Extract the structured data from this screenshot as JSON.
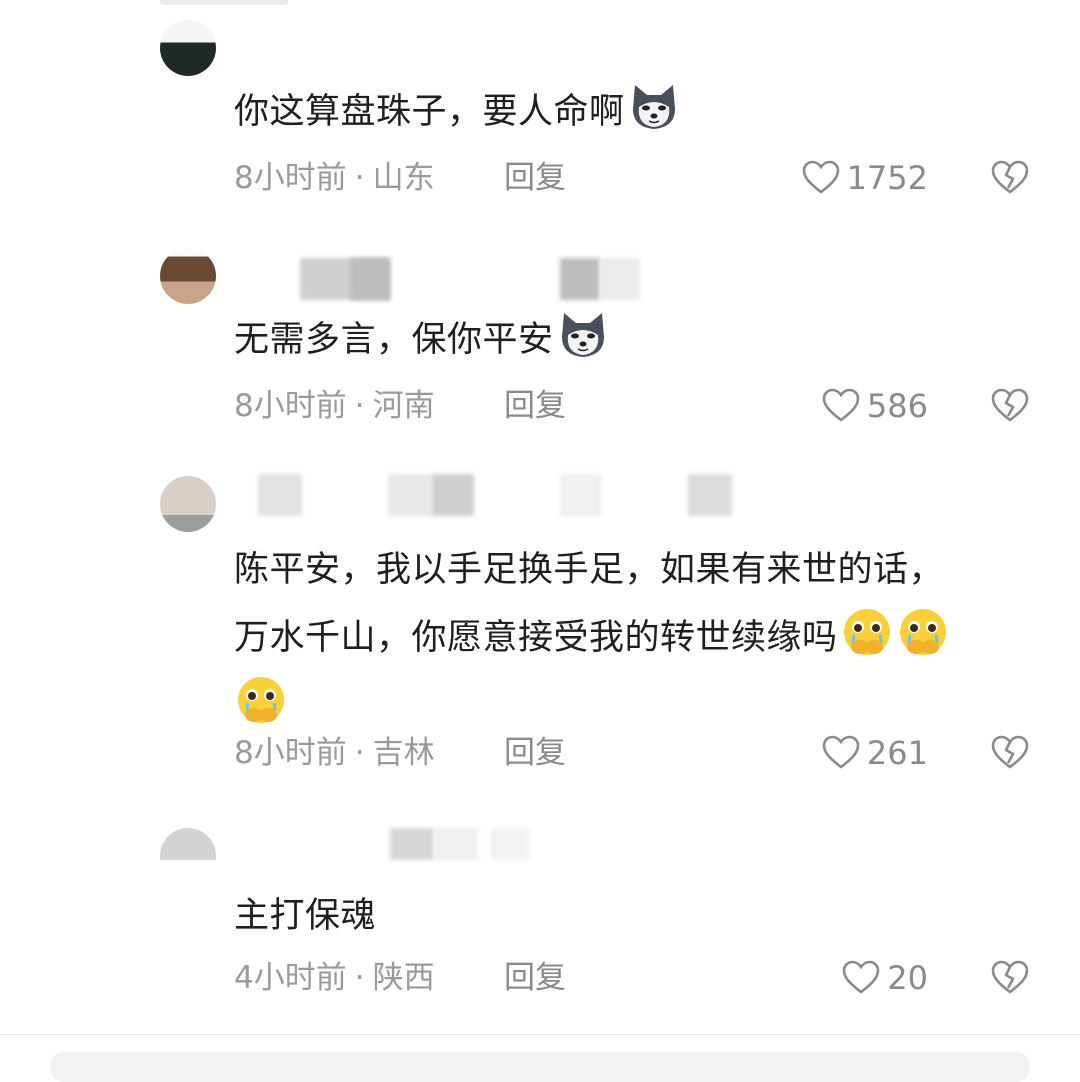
{
  "comments": [
    {
      "text": "你这算盘珠子，要人命啊",
      "emojis": [
        "husky-emoji"
      ],
      "time": "8小时前",
      "location": "山东",
      "reply": "回复",
      "likes": "1752"
    },
    {
      "text": "无需多言，保你平安",
      "emojis": [
        "husky-emoji"
      ],
      "time": "8小时前",
      "location": "河南",
      "reply": "回复",
      "likes": "586"
    },
    {
      "text_line1": "陈平安，我以手足换手足，如果有来世的话，",
      "text_line2": "万水千山，你愿意接受我的转世续缘吗",
      "emojis": [
        "pleading-emoji",
        "pleading-emoji",
        "pleading-emoji"
      ],
      "time": "8小时前",
      "location": "吉林",
      "reply": "回复",
      "likes": "261"
    },
    {
      "text": "主打保魂",
      "emojis": [],
      "time": "4小时前",
      "location": "陕西",
      "reply": "回复",
      "likes": "20"
    }
  ],
  "separator": "·",
  "colors": {
    "meta_text": "#9a9a9a",
    "comment_text": "#1f1f1f",
    "background": "#ffffff"
  }
}
